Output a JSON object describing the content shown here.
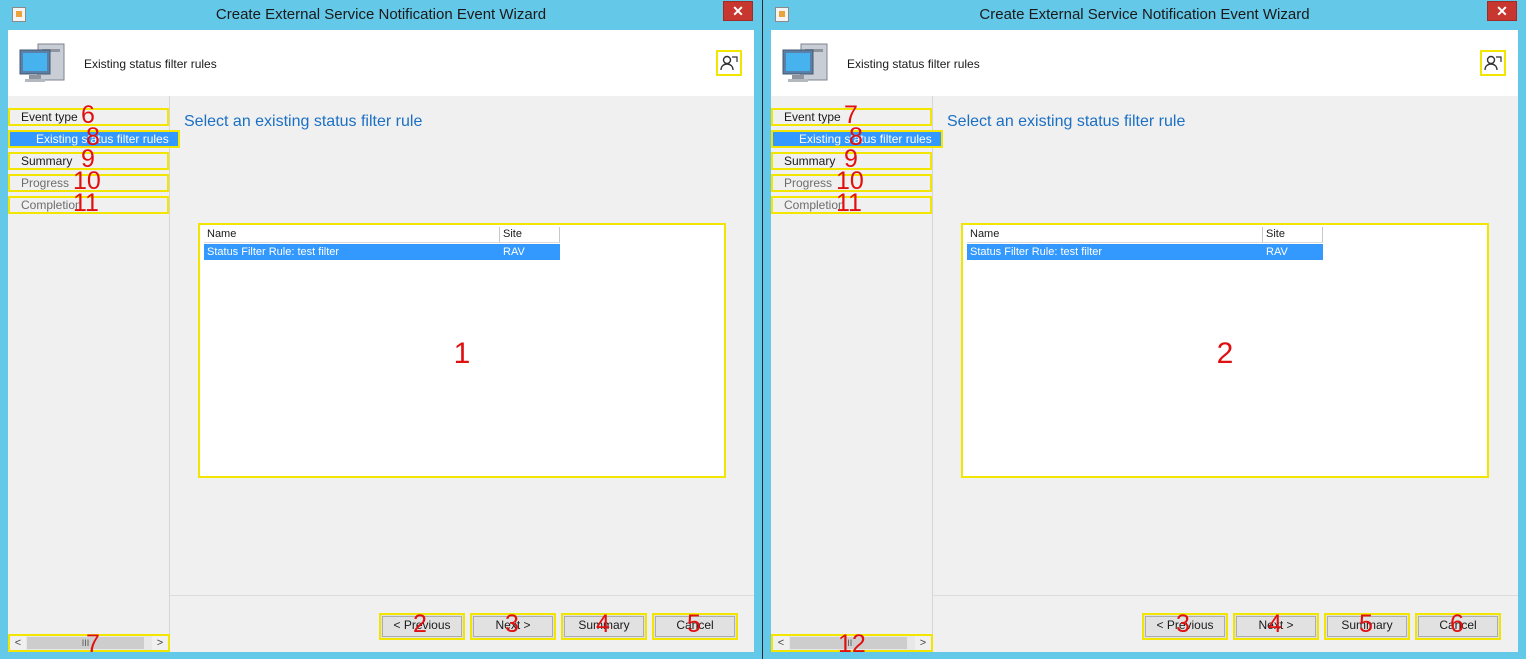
{
  "colors": {
    "title_bar": "#64c8e8",
    "highlight": "#3399ff",
    "annotation": "#e01010",
    "annotation_box": "#f2e600",
    "heading": "#1b70c4",
    "close": "#c7372f"
  },
  "panels": [
    {
      "window_title": "Create External Service Notification Event Wizard",
      "close_label": "✕",
      "header_title": "Existing status filter rules",
      "header_icon": "computer-icon",
      "help_icon": "help-user-icon",
      "nav": [
        {
          "label": "Event type",
          "num": "6"
        },
        {
          "label": "Existing status filter rules",
          "num": "8"
        },
        {
          "label": "Summary",
          "num": "9"
        },
        {
          "label": "Progress",
          "num": "10"
        },
        {
          "label": "Completion",
          "num": "11"
        }
      ],
      "scrollbar": {
        "left_arrow": "<",
        "right_arrow": ">",
        "thumb": "III",
        "num": "7"
      },
      "main_heading": "Select an existing status filter rule",
      "table": {
        "columns": [
          "Name",
          "Site"
        ],
        "rows": [
          {
            "name": "Status Filter Rule: test filter",
            "site": "RAV"
          }
        ]
      },
      "list_num": "1",
      "buttons": [
        {
          "label": "< Previous",
          "num": "2"
        },
        {
          "label": "Next >",
          "num": "3"
        },
        {
          "label": "Summary",
          "num": "4"
        },
        {
          "label": "Cancel",
          "num": "5"
        }
      ]
    },
    {
      "window_title": "Create External Service Notification Event Wizard",
      "close_label": "✕",
      "header_title": "Existing status filter rules",
      "header_icon": "computer-icon",
      "help_icon": "help-user-icon",
      "nav": [
        {
          "label": "Event type",
          "num": "7"
        },
        {
          "label": "Existing status filter rules",
          "num": "8"
        },
        {
          "label": "Summary",
          "num": "9"
        },
        {
          "label": "Progress",
          "num": "10"
        },
        {
          "label": "Completion",
          "num": "11"
        }
      ],
      "scrollbar": {
        "left_arrow": "<",
        "right_arrow": ">",
        "thumb": "III",
        "num": "12"
      },
      "main_heading": "Select an existing status filter rule",
      "table": {
        "columns": [
          "Name",
          "Site"
        ],
        "rows": [
          {
            "name": "Status Filter Rule: test filter",
            "site": "RAV"
          }
        ]
      },
      "list_num": "2",
      "buttons": [
        {
          "label": "< Previous",
          "num": "3"
        },
        {
          "label": "Next >",
          "num": "4"
        },
        {
          "label": "Summary",
          "num": "5"
        },
        {
          "label": "Cancel",
          "num": "6"
        }
      ]
    }
  ]
}
